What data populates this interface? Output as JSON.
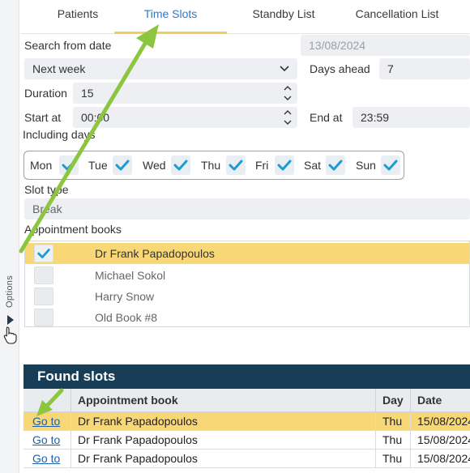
{
  "sidebar": {
    "options_label": "Options"
  },
  "tabs": [
    {
      "label": "Patients",
      "active": false
    },
    {
      "label": "Time Slots",
      "active": true
    },
    {
      "label": "Standby List",
      "active": false
    },
    {
      "label": "Cancellation List",
      "active": false
    }
  ],
  "form": {
    "search_from_label": "Search from date",
    "search_from_value": "13/08/2024",
    "range_value": "Next week",
    "days_ahead_label": "Days ahead",
    "days_ahead_value": "7",
    "duration_label": "Duration",
    "duration_value": "15",
    "start_label": "Start at",
    "start_value": "00:00",
    "end_label": "End at",
    "end_value": "23:59",
    "including_days_label": "Including days",
    "days": [
      {
        "name": "Mon",
        "checked": true
      },
      {
        "name": "Tue",
        "checked": true
      },
      {
        "name": "Wed",
        "checked": true
      },
      {
        "name": "Thu",
        "checked": true
      },
      {
        "name": "Fri",
        "checked": true
      },
      {
        "name": "Sat",
        "checked": true
      },
      {
        "name": "Sun",
        "checked": true
      }
    ],
    "slot_type_label": "Slot type",
    "slot_type_value": "Break",
    "appointment_books_label": "Appointment books",
    "books": [
      {
        "name": "Dr Frank Papadopoulos",
        "checked": true,
        "selected": true
      },
      {
        "name": "Michael Sokol",
        "checked": false,
        "selected": false
      },
      {
        "name": "Harry Snow",
        "checked": false,
        "selected": false
      },
      {
        "name": "Old Book #8",
        "checked": false,
        "selected": false
      }
    ]
  },
  "results": {
    "title": "Found slots",
    "columns": {
      "book": "Appointment book",
      "day": "Day",
      "date": "Date"
    },
    "rows": [
      {
        "link": "Go to",
        "book": "Dr Frank Papadopoulos",
        "day": "Thu",
        "date": "15/08/2024",
        "selected": true
      },
      {
        "link": "Go to",
        "book": "Dr Frank Papadopoulos",
        "day": "Thu",
        "date": "15/08/2024",
        "selected": false
      },
      {
        "link": "Go to",
        "book": "Dr Frank Papadopoulos",
        "day": "Thu",
        "date": "15/08/2024",
        "selected": false
      }
    ]
  },
  "colors": {
    "accent_blue": "#2c79c9",
    "check_teal": "#1c9ad6",
    "selection_yellow": "#f8d776",
    "header_navy": "#173d57",
    "annotation_green": "#8cc63f"
  }
}
